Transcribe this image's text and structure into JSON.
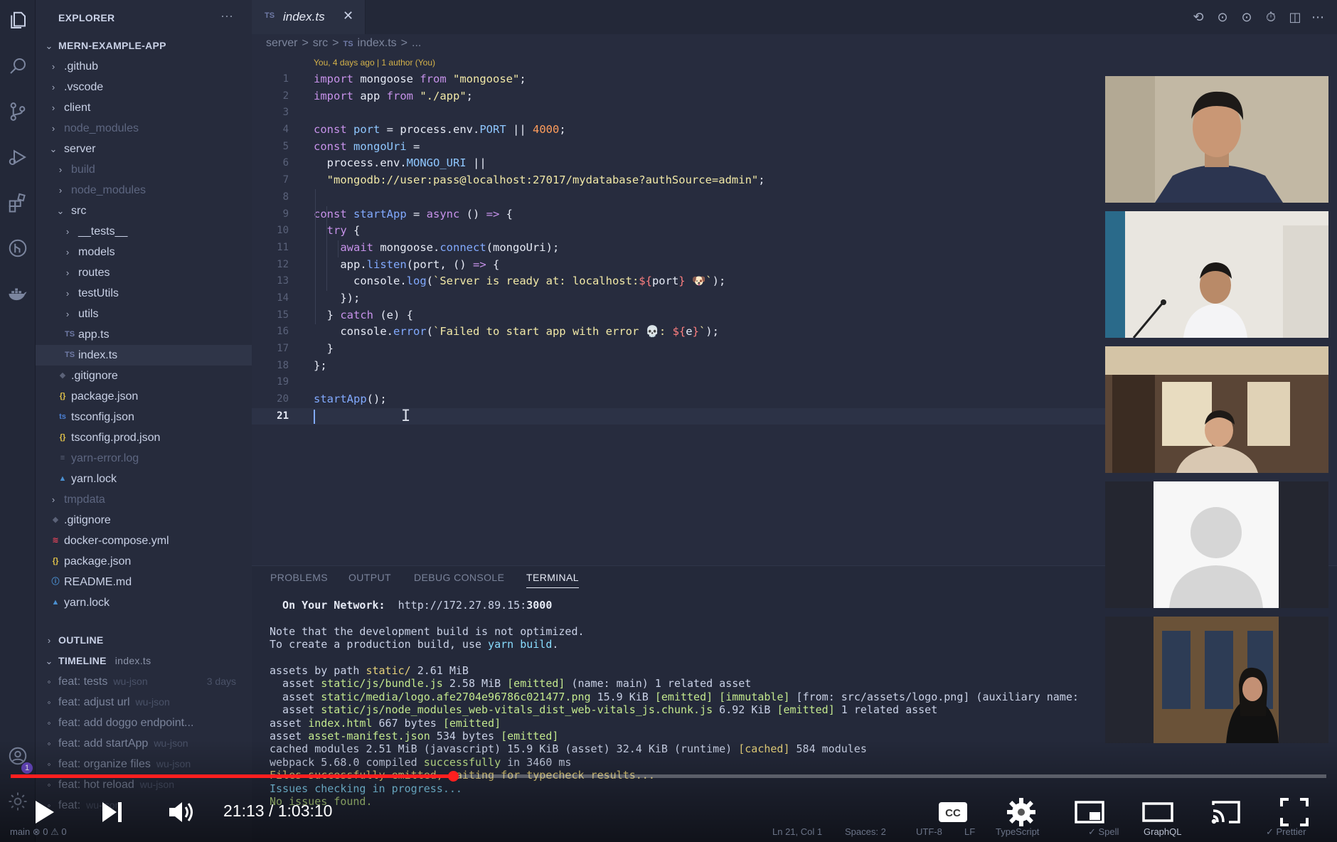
{
  "explorer": {
    "title": "EXPLORER",
    "more": "···",
    "project": "MERN-EXAMPLE-APP",
    "items": [
      {
        "label": ".github",
        "depth": 1,
        "type": "folder",
        "open": false
      },
      {
        "label": ".vscode",
        "depth": 1,
        "type": "folder",
        "open": false
      },
      {
        "label": "client",
        "depth": 1,
        "type": "folder",
        "open": false
      },
      {
        "label": "node_modules",
        "depth": 1,
        "type": "folder",
        "open": false,
        "dim": true
      },
      {
        "label": "server",
        "depth": 1,
        "type": "folder",
        "open": true
      },
      {
        "label": "build",
        "depth": 2,
        "type": "folder",
        "open": false,
        "dim": true
      },
      {
        "label": "node_modules",
        "depth": 2,
        "type": "folder",
        "open": false,
        "dim": true
      },
      {
        "label": "src",
        "depth": 2,
        "type": "folder",
        "open": true
      },
      {
        "label": "__tests__",
        "depth": 3,
        "type": "folder",
        "open": false
      },
      {
        "label": "models",
        "depth": 3,
        "type": "folder",
        "open": false
      },
      {
        "label": "routes",
        "depth": 3,
        "type": "folder",
        "open": false
      },
      {
        "label": "testUtils",
        "depth": 3,
        "type": "folder",
        "open": false
      },
      {
        "label": "utils",
        "depth": 3,
        "type": "folder",
        "open": false
      },
      {
        "label": "app.ts",
        "depth": 3,
        "type": "file",
        "icon": "TS",
        "color": "#6f7aa6"
      },
      {
        "label": "index.ts",
        "depth": 3,
        "type": "file",
        "icon": "TS",
        "color": "#6f7aa6",
        "selected": true
      },
      {
        "label": ".gitignore",
        "depth": 2,
        "type": "file",
        "icon": "◆",
        "color": "#5b6278"
      },
      {
        "label": "package.json",
        "depth": 2,
        "type": "file",
        "icon": "{}",
        "color": "#e0c24a"
      },
      {
        "label": "tsconfig.json",
        "depth": 2,
        "type": "file",
        "icon": "ts",
        "color": "#4a7ed0"
      },
      {
        "label": "tsconfig.prod.json",
        "depth": 2,
        "type": "file",
        "icon": "{}",
        "color": "#e0c24a"
      },
      {
        "label": "yarn-error.log",
        "depth": 2,
        "type": "file",
        "icon": "≡",
        "color": "#5b6278",
        "dim": true
      },
      {
        "label": "yarn.lock",
        "depth": 2,
        "type": "file",
        "icon": "▲",
        "color": "#4a8fd0"
      },
      {
        "label": "tmpdata",
        "depth": 1,
        "type": "folder",
        "open": false,
        "dim": true
      },
      {
        "label": ".gitignore",
        "depth": 1,
        "type": "file",
        "icon": "◆",
        "color": "#5b6278"
      },
      {
        "label": "docker-compose.yml",
        "depth": 1,
        "type": "file",
        "icon": "≋",
        "color": "#e0445a"
      },
      {
        "label": "package.json",
        "depth": 1,
        "type": "file",
        "icon": "{}",
        "color": "#e0c24a"
      },
      {
        "label": "README.md",
        "depth": 1,
        "type": "file",
        "icon": "ⓘ",
        "color": "#4a8fd0"
      },
      {
        "label": "yarn.lock",
        "depth": 1,
        "type": "file",
        "icon": "▲",
        "color": "#4a8fd0"
      }
    ],
    "outline": "OUTLINE",
    "timeline": {
      "title": "TIMELINE",
      "file": "index.ts",
      "entries": [
        {
          "message": "feat: tests",
          "author": "wu-json",
          "when": "3 days"
        },
        {
          "message": "feat: adjust url",
          "author": "wu-json",
          "when": ""
        },
        {
          "message": "feat: add doggo endpoint...",
          "author": "",
          "when": ""
        },
        {
          "message": "feat: add startApp",
          "author": "wu-json",
          "when": ""
        },
        {
          "message": "feat: organize files",
          "author": "wu-json",
          "when": ""
        },
        {
          "message": "feat: hot reload",
          "author": "wu-json",
          "when": ""
        },
        {
          "message": "feat:",
          "author": "wu-json",
          "when": ""
        }
      ]
    }
  },
  "editor": {
    "tab": {
      "icon": "TS",
      "name": "index.ts",
      "close": "✕"
    },
    "breadcrumb": [
      "server",
      ">",
      "src",
      ">",
      "TS",
      "index.ts",
      ">",
      "..."
    ],
    "blame": "You, 4 days ago | 1 author (You)",
    "current_line": 21
  },
  "panel": {
    "tabs": [
      "PROBLEMS",
      "OUTPUT",
      "DEBUG CONSOLE",
      "TERMINAL"
    ],
    "active_tab": "TERMINAL"
  },
  "video_tiles": [
    {
      "name": "participant-1"
    },
    {
      "name": "participant-2"
    },
    {
      "name": "participant-3"
    },
    {
      "name": "participant-4-placeholder"
    },
    {
      "name": "participant-5"
    }
  ],
  "player": {
    "time_current": "21:13",
    "time_separator": "/",
    "time_total": "1:03:10",
    "progress": 0.336,
    "accent": "#ff1f1f"
  },
  "statusbar": {
    "left": "main   ⊗ 0 ⚠ 0",
    "position": "Ln 21, Col 1",
    "spaces": "Spaces: 2",
    "encoding": "UTF-8",
    "eol": "LF",
    "language": "TypeScript",
    "spell": "✓ Spell",
    "graphql": "GraphQL",
    "prettier": "✓ Prettier"
  }
}
